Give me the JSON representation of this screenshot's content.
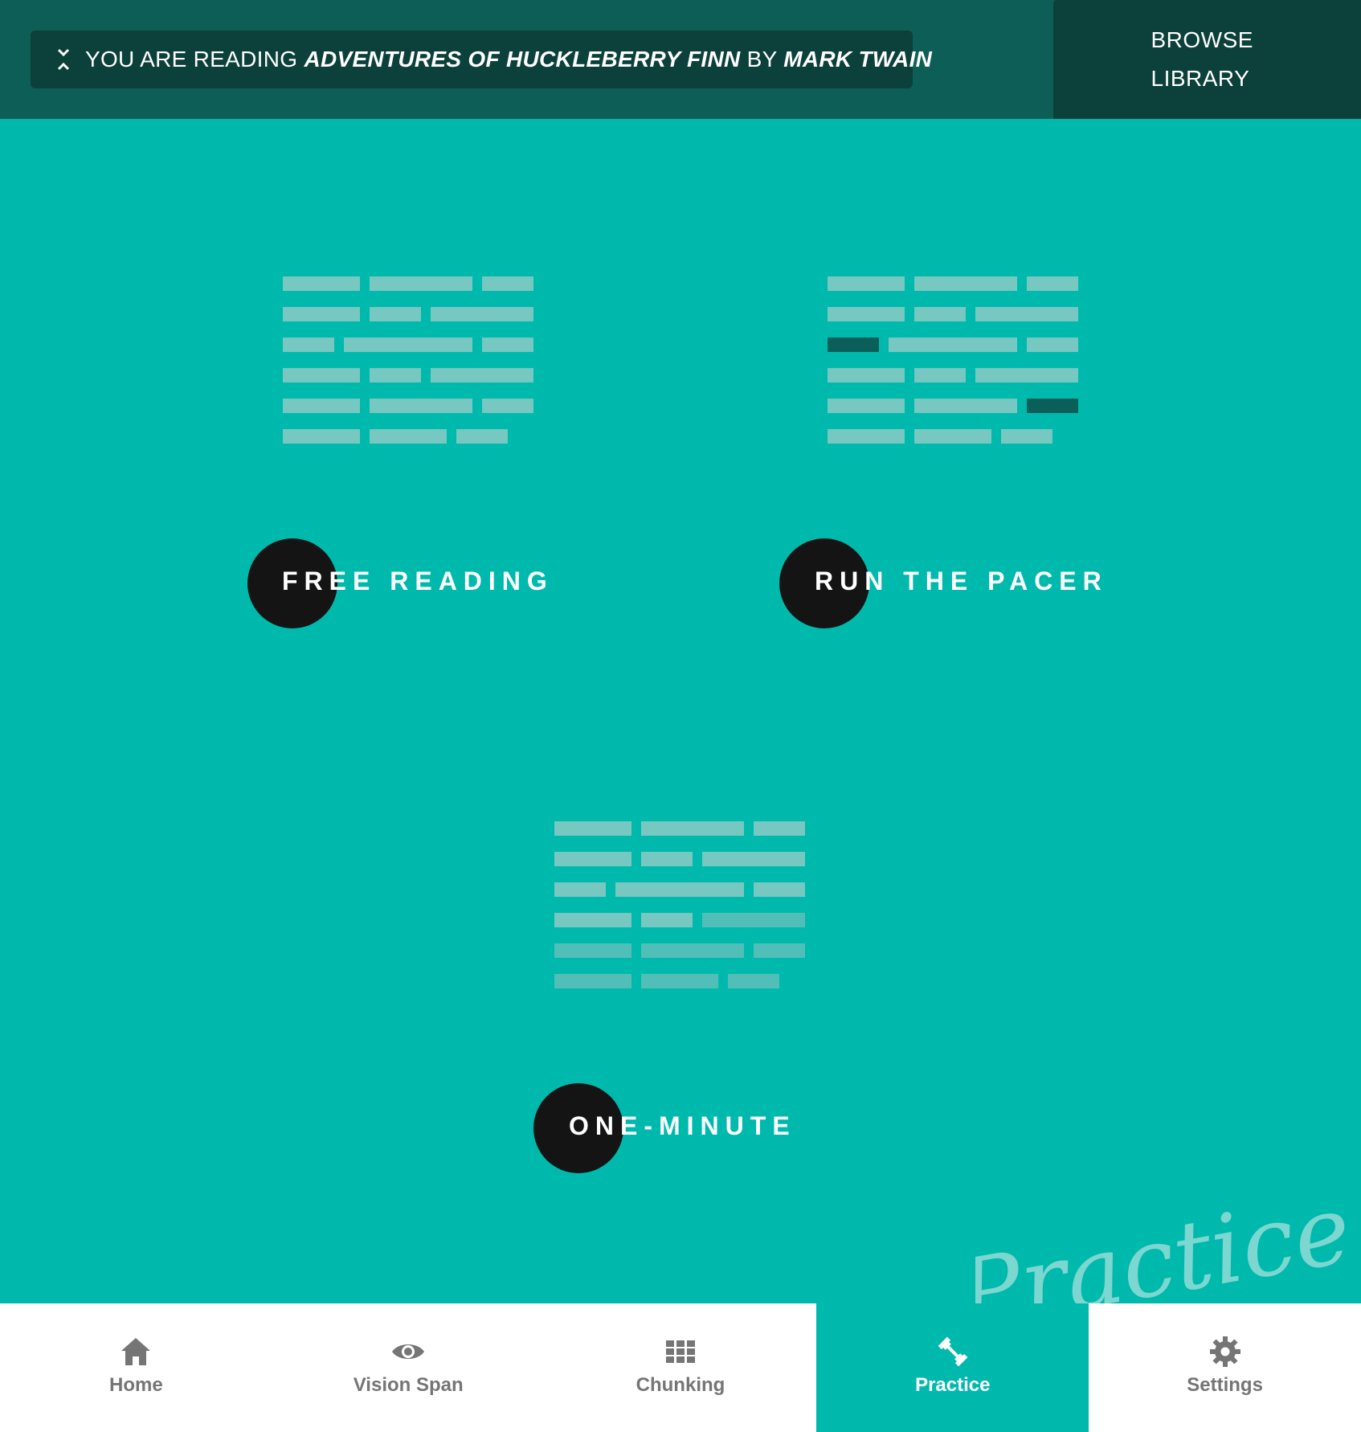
{
  "header": {
    "reading_prefix": "YOU ARE READING",
    "book_title": "ADVENTURES OF HUCKLEBERRY FINN",
    "by": "BY",
    "author": "MARK TWAIN",
    "browse_line1": "BROWSE",
    "browse_line2": "LIBRARY",
    "collapse_icon": "collapse-arrows-icon"
  },
  "modes": [
    {
      "label": "FREE READING"
    },
    {
      "label": "RUN THE PACER"
    },
    {
      "label": "ONE-MINUTE"
    }
  ],
  "watermark": "Practice",
  "nav": [
    {
      "label": "Home",
      "icon": "home-icon"
    },
    {
      "label": "Vision Span",
      "icon": "eye-icon"
    },
    {
      "label": "Chunking",
      "icon": "grid-icon"
    },
    {
      "label": "Practice",
      "icon": "dumbbell-icon",
      "active": true
    },
    {
      "label": "Settings",
      "icon": "gear-icon"
    }
  ],
  "colors": {
    "background": "#00b9ad",
    "topbar": "#0d5e56",
    "pill": "#0c403b",
    "circle": "#141414",
    "highlight_bar": "#0c5f58"
  }
}
